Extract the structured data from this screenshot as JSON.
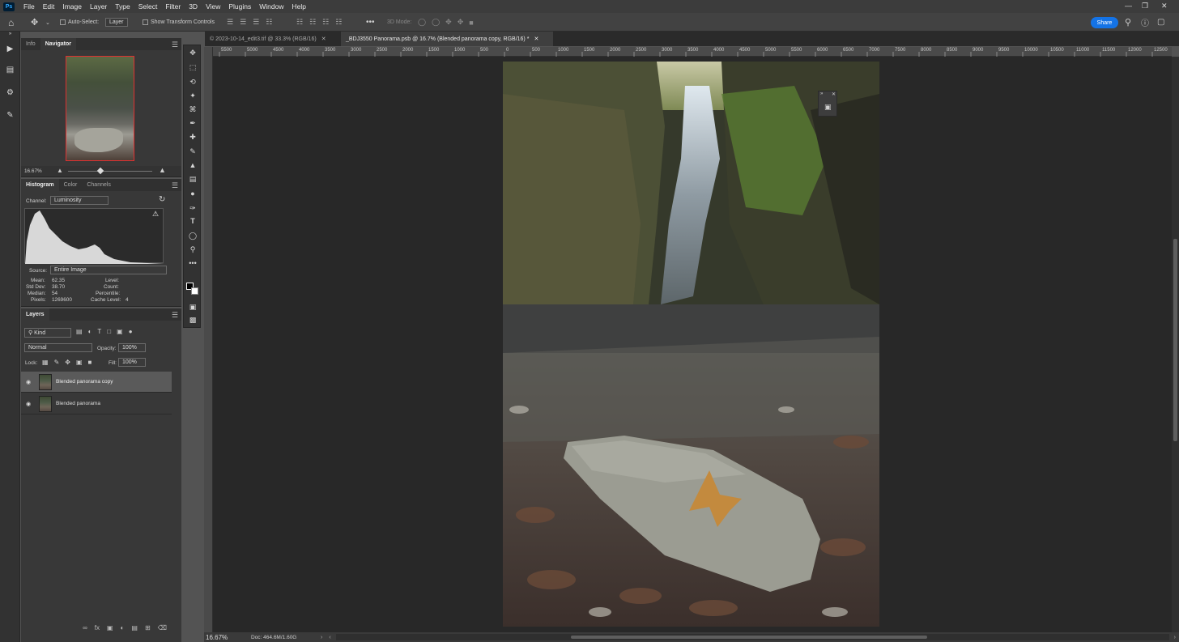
{
  "app": {
    "logo": "Ps"
  },
  "menu": [
    "File",
    "Edit",
    "Image",
    "Layer",
    "Type",
    "Select",
    "Filter",
    "3D",
    "View",
    "Plugins",
    "Window",
    "Help"
  ],
  "options": {
    "auto_select_label": "Auto-Select:",
    "auto_select_target": "Layer",
    "show_transform_label": "Show Transform Controls",
    "mode_3d_label": "3D Mode:",
    "share_label": "Share"
  },
  "navigator": {
    "tabs": [
      "Info",
      "Navigator"
    ],
    "zoom": "16.67%"
  },
  "histogram": {
    "tabs": [
      "Histogram",
      "Color",
      "Channels"
    ],
    "channel_label": "Channel:",
    "channel": "Luminosity",
    "source_label": "Source:",
    "source": "Entire Image",
    "stats": {
      "mean_label": "Mean:",
      "mean": "62.35",
      "stddev_label": "Std Dev:",
      "stddev": "38.70",
      "median_label": "Median:",
      "median": "54",
      "pixels_label": "Pixels:",
      "pixels": "1269600",
      "level_label": "Level:",
      "count_label": "Count:",
      "percentile_label": "Percentile:",
      "cache_label": "Cache Level:",
      "cache": "4"
    }
  },
  "layers": {
    "tab": "Layers",
    "filter": "Kind",
    "blend": "Normal",
    "opacity_label": "Opacity:",
    "opacity": "100%",
    "lock_label": "Lock:",
    "fill_label": "Fill:",
    "fill": "100%",
    "items": [
      {
        "name": "Blended panorama copy",
        "selected": true
      },
      {
        "name": "Blended panorama",
        "selected": false
      }
    ]
  },
  "documents": [
    {
      "title": "© 2023-10-14_edit3.tif @ 33.3% (RGB/16)",
      "active": false
    },
    {
      "title": "_BDJ3550 Panorama.psb @ 16.7% (Blended panorama copy, RGB/16) *",
      "active": true
    }
  ],
  "ruler_ticks": [
    "5500",
    "5000",
    "4500",
    "4000",
    "3500",
    "3000",
    "2500",
    "2000",
    "1500",
    "1000",
    "500",
    "0",
    "500",
    "1000",
    "1500",
    "2000",
    "2500",
    "3000",
    "3500",
    "4000",
    "4500",
    "5000",
    "5500",
    "6000",
    "6500",
    "7000",
    "7500",
    "8000",
    "8500",
    "9000",
    "9500",
    "10000",
    "10500",
    "11000",
    "11500",
    "12000",
    "12500"
  ],
  "status": {
    "zoom": "16.67%",
    "doc": "Doc: 464.6M/1.60G"
  },
  "colors": {
    "accent": "#1473e6",
    "canvas": "#282828",
    "panel": "#383838"
  }
}
